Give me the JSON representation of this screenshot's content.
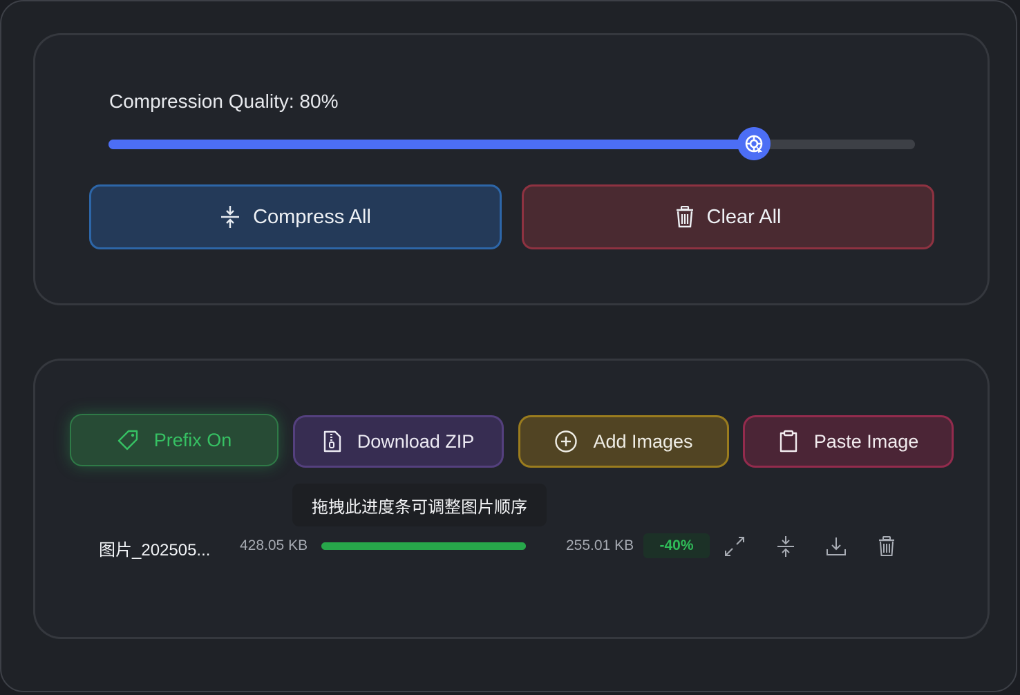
{
  "settings": {
    "quality_label": "Compression Quality: 80%",
    "quality_value": 80,
    "compress_all_label": "Compress All",
    "clear_all_label": "Clear All"
  },
  "toolbar": {
    "prefix_label": "Prefix On",
    "download_zip_label": "Download ZIP",
    "add_images_label": "Add Images",
    "paste_image_label": "Paste Image"
  },
  "tooltip": {
    "text": "拖拽此进度条可调整图片顺序"
  },
  "files": [
    {
      "name": "图片_202505...",
      "original_size": "428.05 KB",
      "progress": 100,
      "compressed_size": "255.01 KB",
      "ratio": "-40%"
    }
  ],
  "colors": {
    "accent_blue": "#4c6ef5",
    "success_green": "#27a74a",
    "danger_red": "#8e3241"
  }
}
